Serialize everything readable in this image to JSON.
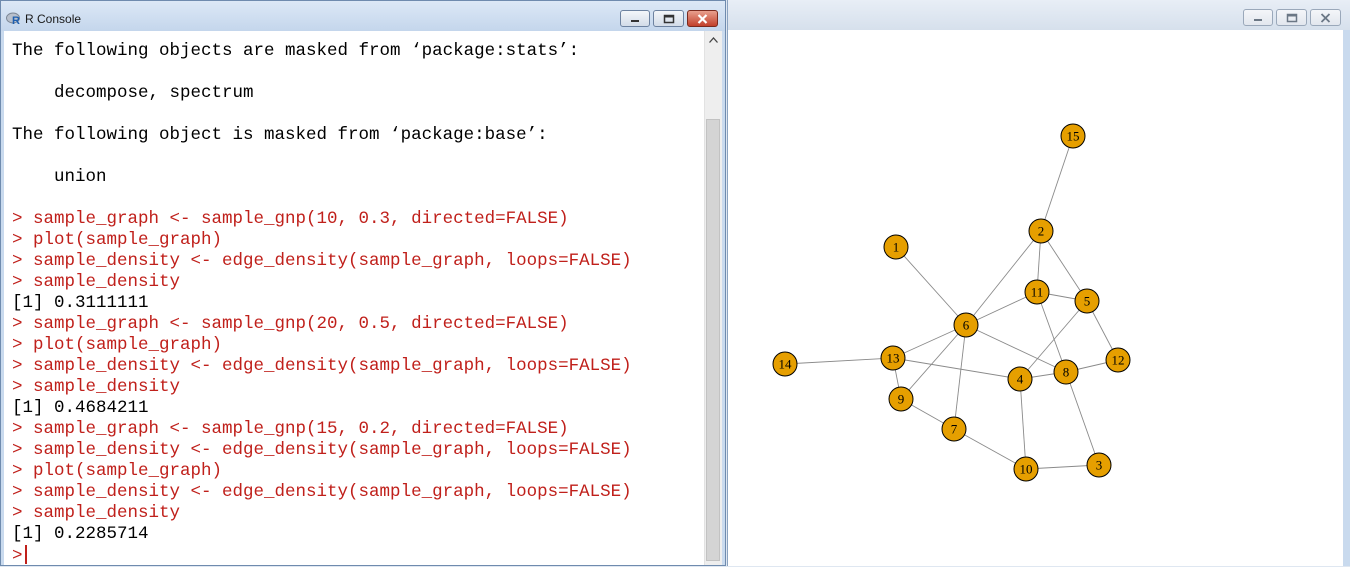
{
  "console_window": {
    "title": "R Console",
    "buttons": {
      "minimize": "minimize",
      "maximize": "maximize",
      "close": "close"
    },
    "lines": [
      {
        "text": "The following objects are masked from ‘package:stats’:",
        "color": "black"
      },
      {
        "text": "",
        "color": "black"
      },
      {
        "text": "    decompose, spectrum",
        "color": "black"
      },
      {
        "text": "",
        "color": "black"
      },
      {
        "text": "The following object is masked from ‘package:base’:",
        "color": "black"
      },
      {
        "text": "",
        "color": "black"
      },
      {
        "text": "    union",
        "color": "black"
      },
      {
        "text": "",
        "color": "black"
      },
      {
        "text": "> sample_graph <- sample_gnp(10, 0.3, directed=FALSE)",
        "color": "red"
      },
      {
        "text": "> plot(sample_graph)",
        "color": "red"
      },
      {
        "text": "> sample_density <- edge_density(sample_graph, loops=FALSE)",
        "color": "red"
      },
      {
        "text": "> sample_density",
        "color": "red"
      },
      {
        "text": "[1] 0.3111111",
        "color": "black"
      },
      {
        "text": "> sample_graph <- sample_gnp(20, 0.5, directed=FALSE)",
        "color": "red"
      },
      {
        "text": "> plot(sample_graph)",
        "color": "red"
      },
      {
        "text": "> sample_density <- edge_density(sample_graph, loops=FALSE)",
        "color": "red"
      },
      {
        "text": "> sample_density",
        "color": "red"
      },
      {
        "text": "[1] 0.4684211",
        "color": "black"
      },
      {
        "text": "> sample_graph <- sample_gnp(15, 0.2, directed=FALSE)",
        "color": "red"
      },
      {
        "text": "> sample_density <- edge_density(sample_graph, loops=FALSE)",
        "color": "red"
      },
      {
        "text": "> plot(sample_graph)",
        "color": "red"
      },
      {
        "text": "> sample_density <- edge_density(sample_graph, loops=FALSE)",
        "color": "red"
      },
      {
        "text": "> sample_density",
        "color": "red"
      },
      {
        "text": "[1] 0.2285714",
        "color": "black"
      }
    ],
    "prompt": ">",
    "colors": {
      "command": "#c0201b",
      "output": "#000000"
    }
  },
  "graph_window": {
    "title": "",
    "node_color": "#e69f00",
    "edge_color": "#8a8a8a",
    "nodes": [
      "1",
      "2",
      "3",
      "4",
      "5",
      "6",
      "7",
      "8",
      "9",
      "10",
      "11",
      "12",
      "13",
      "14",
      "15"
    ],
    "edges": [
      [
        "15",
        "2"
      ],
      [
        "2",
        "11"
      ],
      [
        "2",
        "6"
      ],
      [
        "2",
        "5"
      ],
      [
        "1",
        "6"
      ],
      [
        "11",
        "5"
      ],
      [
        "11",
        "6"
      ],
      [
        "11",
        "8"
      ],
      [
        "5",
        "12"
      ],
      [
        "5",
        "4"
      ],
      [
        "6",
        "13"
      ],
      [
        "6",
        "9"
      ],
      [
        "6",
        "7"
      ],
      [
        "6",
        "8"
      ],
      [
        "14",
        "13"
      ],
      [
        "13",
        "9"
      ],
      [
        "13",
        "4"
      ],
      [
        "9",
        "7"
      ],
      [
        "7",
        "10"
      ],
      [
        "4",
        "8"
      ],
      [
        "4",
        "10"
      ],
      [
        "8",
        "12"
      ],
      [
        "8",
        "3"
      ],
      [
        "10",
        "3"
      ]
    ]
  }
}
